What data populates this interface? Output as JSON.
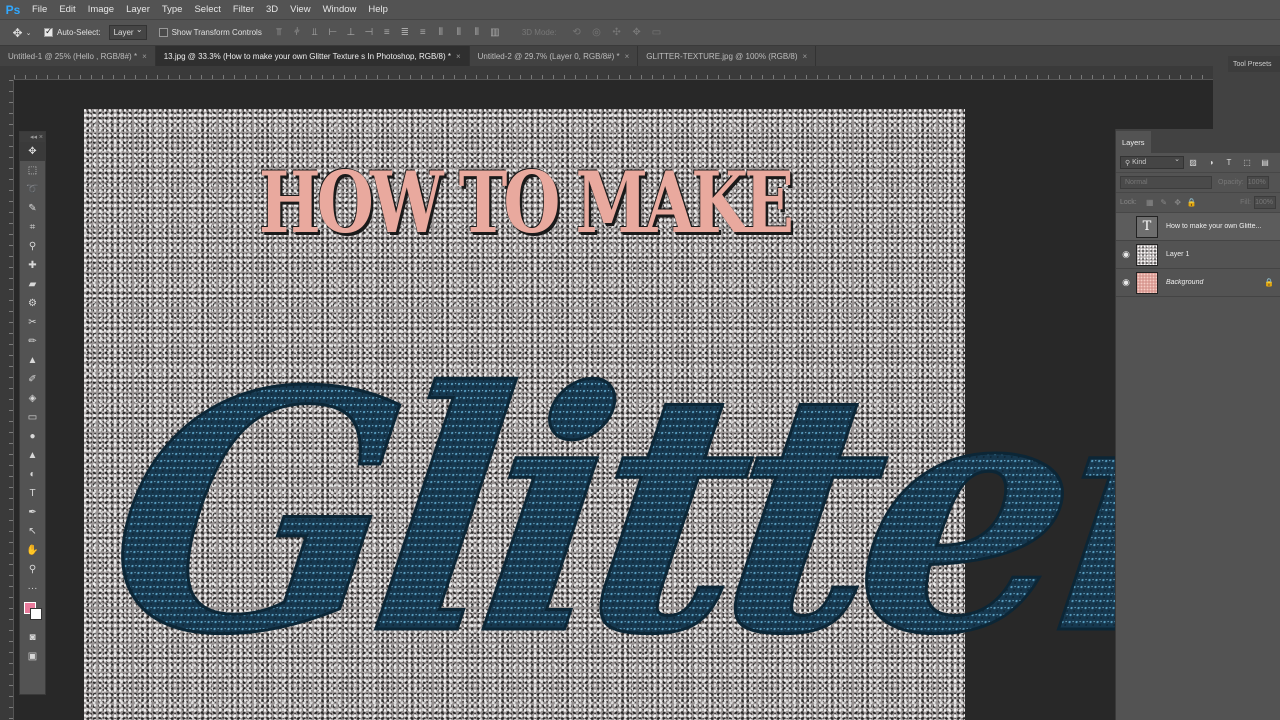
{
  "app": {
    "logo": "Ps"
  },
  "menu": [
    "File",
    "Edit",
    "Image",
    "Layer",
    "Type",
    "Select",
    "Filter",
    "3D",
    "View",
    "Window",
    "Help"
  ],
  "options": {
    "auto_select_label": "Auto-Select:",
    "auto_select_value": "Layer",
    "transform_label": "Show Transform Controls",
    "mode_3d_label": "3D Mode:"
  },
  "tabs": [
    {
      "label": "Untitled-1 @ 25% (Hello , RGB/8#) *",
      "active": false
    },
    {
      "label": "13.jpg @ 33.3% (How to make your own  Glitter Texture s In Photoshop, RGB/8) *",
      "active": true
    },
    {
      "label": "Untitled-2 @ 29.7% (Layer 0, RGB/8#) *",
      "active": false
    },
    {
      "label": "GLITTER-TEXTURE.jpg @ 100% (RGB/8)",
      "active": false
    }
  ],
  "tab_close": "×",
  "artwork": {
    "headline": "HOW TO MAKE",
    "script": "Glitter",
    "headline_color": "#e9a99e",
    "script_color": "#1c4a66"
  },
  "toolbar": {
    "fg_color": "#e87a9b",
    "bg_color": "#ffffff"
  },
  "panels": {
    "tool_presets": "Tool Presets",
    "layers_tab": "Layers",
    "kind_label": "Kind",
    "blend_mode": "Normal",
    "opacity_label": "Opacity:",
    "opacity_value": "100%",
    "lock_label": "Lock:",
    "fill_label": "Fill:",
    "fill_value": "100%"
  },
  "layers": [
    {
      "name": "How to make your own  Glitte...",
      "visible": false,
      "thumb": "text",
      "italic": false,
      "locked": false
    },
    {
      "name": "Layer 1",
      "visible": true,
      "thumb": "glitter",
      "italic": false,
      "locked": false
    },
    {
      "name": "Background",
      "visible": true,
      "thumb": "pink",
      "italic": true,
      "locked": true
    }
  ]
}
